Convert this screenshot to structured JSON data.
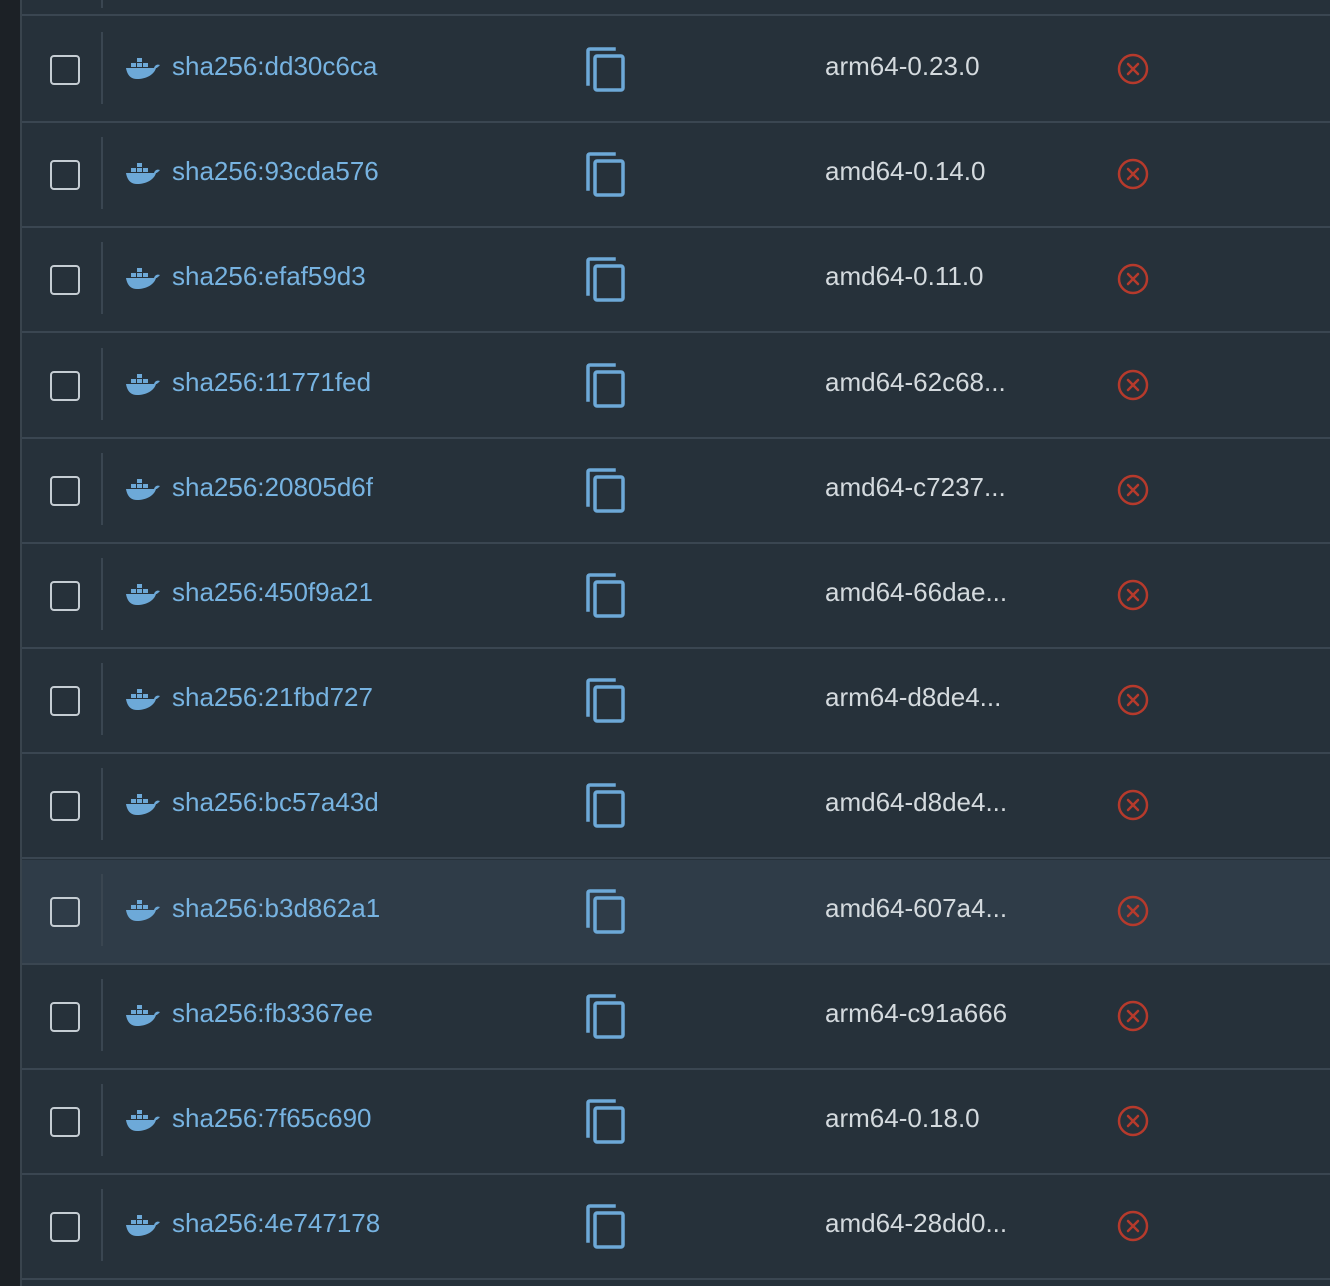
{
  "table": {
    "rows": [
      {
        "digest": "sha256:dd30c6ca",
        "tag": "arm64-0.23.0"
      },
      {
        "digest": "sha256:93cda576",
        "tag": "amd64-0.14.0"
      },
      {
        "digest": "sha256:efaf59d3",
        "tag": "amd64-0.11.0"
      },
      {
        "digest": "sha256:11771fed",
        "tag": "amd64-62c68..."
      },
      {
        "digest": "sha256:20805d6f",
        "tag": "amd64-c7237..."
      },
      {
        "digest": "sha256:450f9a21",
        "tag": "amd64-66dae..."
      },
      {
        "digest": "sha256:21fbd727",
        "tag": "arm64-d8de4..."
      },
      {
        "digest": "sha256:bc57a43d",
        "tag": "amd64-d8de4..."
      },
      {
        "digest": "sha256:b3d862a1",
        "tag": "amd64-607a4...",
        "hovered": true
      },
      {
        "digest": "sha256:fb3367ee",
        "tag": "arm64-c91a666"
      },
      {
        "digest": "sha256:7f65c690",
        "tag": "arm64-0.18.0"
      },
      {
        "digest": "sha256:4e747178",
        "tag": "amd64-28dd0..."
      }
    ]
  },
  "icons": {
    "digest_icon": "docker-whale-icon",
    "copy_icon": "copy-icon",
    "delete_icon": "delete-circle-x-icon"
  },
  "colors": {
    "background": "#26313a",
    "row_hover": "#2f3c48",
    "digest_link": "#77b3e1",
    "tag_text": "#d4dade",
    "copy_icon": "#6da9d8",
    "delete_icon": "#c0392b",
    "divider": "#3a4651"
  }
}
